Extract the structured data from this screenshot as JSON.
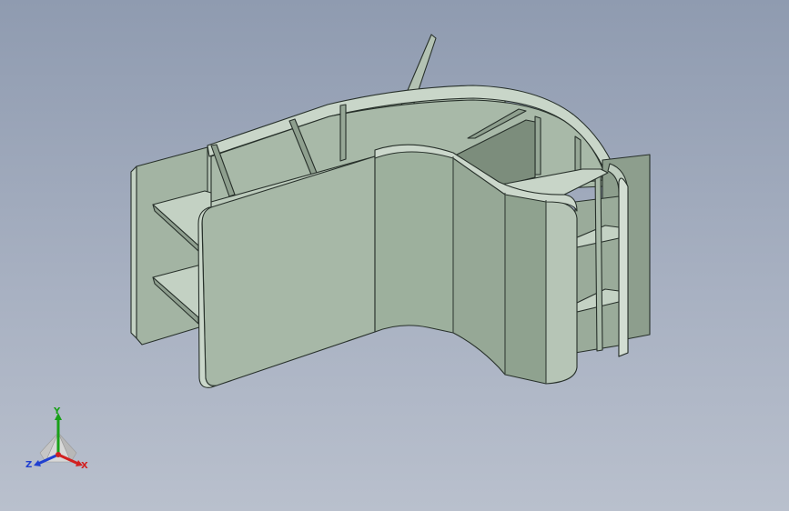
{
  "triad": {
    "x_label": "X",
    "y_label": "Y",
    "z_label": "Z"
  },
  "colors": {
    "background_top": "#8f9bb0",
    "background_bottom": "#b9c0cd",
    "part_light": "#b7c6b7",
    "part_mid": "#a5b6a5",
    "part_dark": "#7f907f",
    "edge": "#27302a",
    "axis_x": "#d22020",
    "axis_y": "#18a018",
    "axis_z": "#2040d0"
  }
}
